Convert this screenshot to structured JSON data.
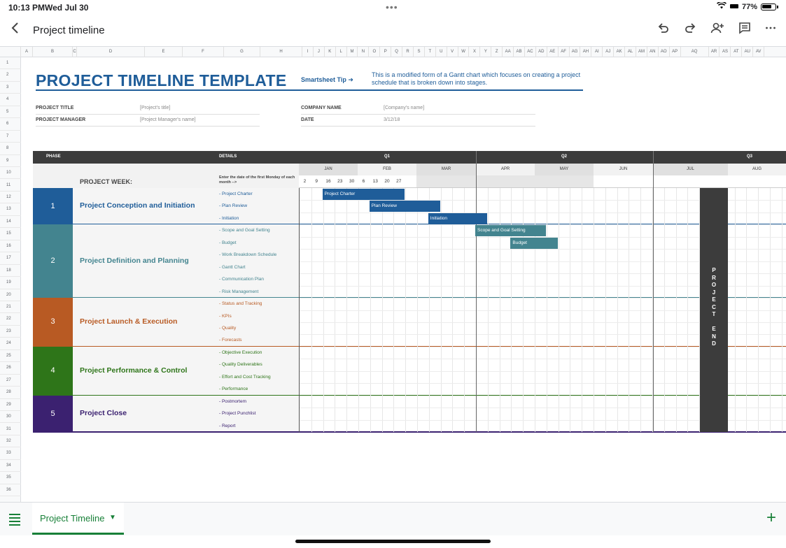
{
  "status": {
    "time": "10:13 PM",
    "date": "Wed Jul 30",
    "battery": "77%"
  },
  "app": {
    "title": "Project timeline"
  },
  "columns": [
    "A",
    "B",
    "C",
    "D",
    "E",
    "F",
    "G",
    "H",
    "I",
    "J",
    "K",
    "L",
    "M",
    "N",
    "O",
    "P",
    "Q",
    "R",
    "S",
    "T",
    "U",
    "V",
    "W",
    "X",
    "Y",
    "Z",
    "AA",
    "AB",
    "AC",
    "AD",
    "AE",
    "AF",
    "AG",
    "AH",
    "AI",
    "AJ",
    "AK",
    "AL",
    "AM",
    "AN",
    "AO",
    "AP",
    "AQ",
    "AR",
    "AS",
    "AT",
    "AU",
    "AV"
  ],
  "rows": [
    "1",
    "2",
    "3",
    "4",
    "5",
    "6",
    "7",
    "8",
    "9",
    "10",
    "11",
    "12",
    "13",
    "14",
    "15",
    "16",
    "17",
    "18",
    "19",
    "20",
    "21",
    "22",
    "23",
    "24",
    "25",
    "26",
    "27",
    "28",
    "29",
    "30",
    "31",
    "32",
    "33",
    "34",
    "35",
    "36"
  ],
  "template": {
    "title": "PROJECT TIMELINE TEMPLATE",
    "tip": "Smartsheet Tip ➜",
    "tip_desc": "This is a modified form of a Gantt chart which focuses on creating a project schedule that is broken down into stages."
  },
  "meta": {
    "project_title_label": "PROJECT TITLE",
    "project_title_value": "[Project's title]",
    "project_manager_label": "PROJECT MANAGER",
    "project_manager_value": "[Project Manager's name]",
    "company_label": "COMPANY NAME",
    "company_value": "[Company's name]",
    "date_label": "DATE",
    "date_value": "3/12/18"
  },
  "gantt": {
    "phase_header": "PHASE",
    "details_header": "DETAILS",
    "quarters": [
      "Q1",
      "Q2",
      "Q3"
    ],
    "months": [
      "JAN",
      "FEB",
      "MAR",
      "APR",
      "MAY",
      "JUN",
      "JUL",
      "AUG"
    ],
    "weeks": [
      "2",
      "9",
      "16",
      "23",
      "30",
      "6",
      "13",
      "20",
      "27"
    ],
    "project_week": "PROJECT WEEK:",
    "enter_date": "Enter the date of the first Monday of each month -->",
    "project_end": "PROJECT END",
    "phases": [
      {
        "num": "1",
        "name": "Project Conception and Initiation",
        "color": "#1f5d99",
        "details": [
          "- Project Charter",
          "- Plan Review",
          "- Initiation"
        ]
      },
      {
        "num": "2",
        "name": "Project Definition and Planning",
        "color": "#43848f",
        "details": [
          "- Scope and Goal Setting",
          "- Budget",
          "- Work Breakdown Schedule",
          "- Gantt Chart",
          "- Communication Plan",
          "- Risk Management"
        ]
      },
      {
        "num": "3",
        "name": "Project Launch & Execution",
        "color": "#b85a23",
        "details": [
          "- Status and Tracking",
          "- KPIs",
          "- Quality",
          "- Forecasts"
        ]
      },
      {
        "num": "4",
        "name": "Project Performance & Control",
        "color": "#2e7519",
        "details": [
          "- Objective Execution",
          "- Quality Deliverables",
          "- Effort and Cost Tracking",
          "- Performance"
        ]
      },
      {
        "num": "5",
        "name": "Project Close",
        "color": "#3b2170",
        "details": [
          "- Postmortem",
          "- Project Punchlist",
          "- Report"
        ]
      }
    ],
    "bars": [
      {
        "label": "Project Charter",
        "color": "#1f5d99"
      },
      {
        "label": "Plan Review",
        "color": "#1f5d99"
      },
      {
        "label": "Initiation",
        "color": "#1f5d99"
      },
      {
        "label": "Scope and Goal Setting",
        "color": "#43848f"
      },
      {
        "label": "Budget",
        "color": "#43848f"
      }
    ]
  },
  "sheet_tab": {
    "label": "Project Timeline"
  }
}
